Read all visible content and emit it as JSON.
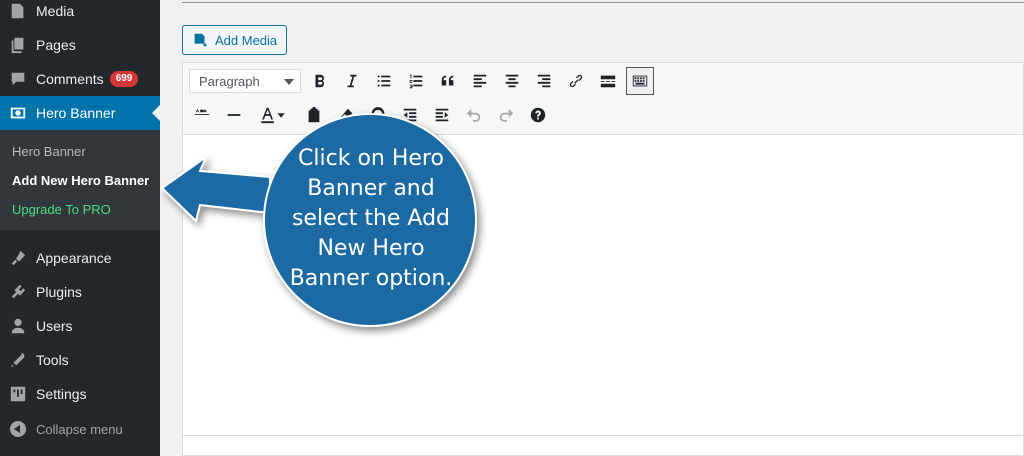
{
  "sidebar": {
    "items": [
      {
        "label": "Media",
        "icon": "media-icon"
      },
      {
        "label": "Pages",
        "icon": "pages-icon"
      },
      {
        "label": "Comments",
        "icon": "comments-icon",
        "badge": "699"
      },
      {
        "label": "Hero Banner",
        "icon": "hero-banner-icon"
      },
      {
        "label": "Appearance",
        "icon": "appearance-icon"
      },
      {
        "label": "Plugins",
        "icon": "plugins-icon"
      },
      {
        "label": "Users",
        "icon": "users-icon"
      },
      {
        "label": "Tools",
        "icon": "tools-icon"
      },
      {
        "label": "Settings",
        "icon": "settings-icon"
      }
    ],
    "submenu": [
      "Hero Banner",
      "Add New Hero Banner",
      "Upgrade To PRO"
    ],
    "collapse_label": "Collapse menu"
  },
  "editor": {
    "add_media_label": "Add Media",
    "format_value": "Paragraph"
  },
  "callout": {
    "lines": [
      "Click on Hero",
      "Banner and",
      "select the Add",
      "New Hero",
      "Banner option."
    ]
  },
  "colors": {
    "sidebar_bg": "#23282d",
    "active_menu": "#0073aa",
    "callout_blue": "#1a6aa3",
    "badge_red": "#d63638"
  }
}
